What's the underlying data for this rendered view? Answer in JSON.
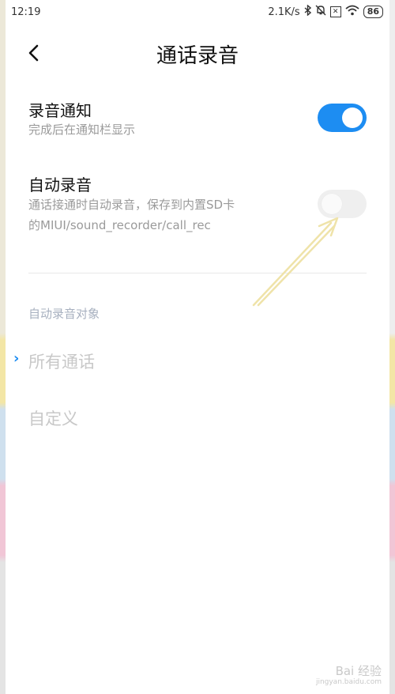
{
  "status_bar": {
    "time": "12:19",
    "network_speed": "2.1K/s",
    "battery": "86"
  },
  "header": {
    "title": "通话录音"
  },
  "settings": {
    "notify": {
      "title": "录音通知",
      "subtitle": "完成后在通知栏显示",
      "enabled": true
    },
    "auto_record": {
      "title": "自动录音",
      "subtitle_line1": "通话接通时自动录音，保存到内置SD卡",
      "subtitle_line2": "的MIUI/sound_recorder/call_rec",
      "enabled": false
    }
  },
  "auto_target": {
    "label": "自动录音对象",
    "options": [
      {
        "label": "所有通话",
        "selected": true
      },
      {
        "label": "自定义",
        "selected": false
      }
    ]
  },
  "colors": {
    "accent": "#1d8df2",
    "annotation_arrow": "#efe3a9"
  },
  "watermark": {
    "text": "Bai 经验",
    "url": "jingyan.baidu.com"
  }
}
